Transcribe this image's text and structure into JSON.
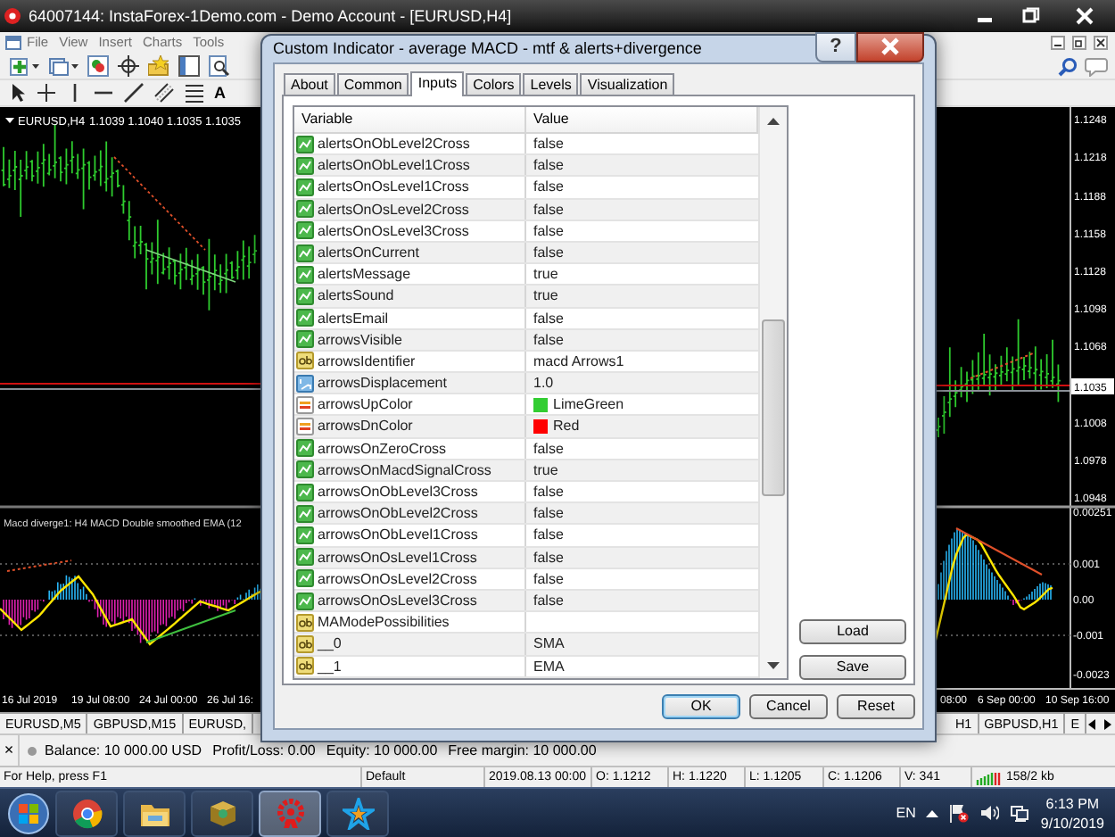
{
  "window": {
    "title": "64007144: InstaForex-1Demo.com - Demo Account - [EURUSD,H4]"
  },
  "menu": [
    "File",
    "View",
    "Insert",
    "Charts",
    "Tools"
  ],
  "text_tool": "A",
  "left_chart": {
    "symbol": "EURUSD,H4",
    "quote": "1.1039 1.1040 1.1035 1.1035",
    "indicator_label": "Macd diverge1: H4 MACD Double smoothed EMA (12",
    "time_labels": [
      "16 Jul 2019",
      "19 Jul 08:00",
      "24 Jul 00:00",
      "26 Jul 16:"
    ]
  },
  "right_chart": {
    "price_labels": [
      "1.1248",
      "1.1218",
      "1.1188",
      "1.1158",
      "1.1128",
      "1.1098",
      "1.1068",
      "1.1008",
      "1.0978",
      "1.0948"
    ],
    "current_price": "1.1035",
    "indicator_labels": [
      "0.00251",
      "0.001",
      "0.00",
      "-0.001",
      "-0.0023"
    ],
    "time_labels": [
      "08:00",
      "6 Sep 00:00",
      "10 Sep 16:00"
    ]
  },
  "dialog": {
    "title": "Custom Indicator - average MACD - mtf & alerts+divergence",
    "help": "?",
    "tabs": [
      {
        "label": "About",
        "selected": false
      },
      {
        "label": "Common",
        "selected": false
      },
      {
        "label": "Inputs",
        "selected": true
      },
      {
        "label": "Colors",
        "selected": false
      },
      {
        "label": "Levels",
        "selected": false
      },
      {
        "label": "Visualization",
        "selected": false
      }
    ],
    "table": {
      "columns": [
        "Variable",
        "Value"
      ],
      "rows": [
        {
          "kind": "bool",
          "variable": "alertsOnObLevel2Cross",
          "value": "false"
        },
        {
          "kind": "bool",
          "variable": "alertsOnObLevel1Cross",
          "value": "false"
        },
        {
          "kind": "bool",
          "variable": "alertsOnOsLevel1Cross",
          "value": "false"
        },
        {
          "kind": "bool",
          "variable": "alertsOnOsLevel2Cross",
          "value": "false"
        },
        {
          "kind": "bool",
          "variable": "alertsOnOsLevel3Cross",
          "value": "false"
        },
        {
          "kind": "bool",
          "variable": "alertsOnCurrent",
          "value": "false"
        },
        {
          "kind": "bool",
          "variable": "alertsMessage",
          "value": "true"
        },
        {
          "kind": "bool",
          "variable": "alertsSound",
          "value": "true"
        },
        {
          "kind": "bool",
          "variable": "alertsEmail",
          "value": "false"
        },
        {
          "kind": "bool",
          "variable": "arrowsVisible",
          "value": "false"
        },
        {
          "kind": "string",
          "variable": "arrowsIdentifier",
          "value": "macd Arrows1"
        },
        {
          "kind": "double",
          "variable": "arrowsDisplacement",
          "value": "1.0"
        },
        {
          "kind": "color",
          "variable": "arrowsUpColor",
          "value": "LimeGreen",
          "color": "#32cd32"
        },
        {
          "kind": "color",
          "variable": "arrowsDnColor",
          "value": "Red",
          "color": "#ff0000"
        },
        {
          "kind": "bool",
          "variable": "arrowsOnZeroCross",
          "value": "false"
        },
        {
          "kind": "bool",
          "variable": "arrowsOnMacdSignalCross",
          "value": "true"
        },
        {
          "kind": "bool",
          "variable": "arrowsOnObLevel3Cross",
          "value": "false"
        },
        {
          "kind": "bool",
          "variable": "arrowsOnObLevel2Cross",
          "value": "false"
        },
        {
          "kind": "bool",
          "variable": "arrowsOnObLevel1Cross",
          "value": "false"
        },
        {
          "kind": "bool",
          "variable": "arrowsOnOsLevel1Cross",
          "value": "false"
        },
        {
          "kind": "bool",
          "variable": "arrowsOnOsLevel2Cross",
          "value": "false"
        },
        {
          "kind": "bool",
          "variable": "arrowsOnOsLevel3Cross",
          "value": "false"
        },
        {
          "kind": "string",
          "variable": "MAModePossibilities"
        },
        {
          "kind": "string",
          "variable": "__0",
          "value": "SMA"
        },
        {
          "kind": "string",
          "variable": "__1",
          "value": "EMA"
        }
      ]
    },
    "side_buttons": [
      "Load",
      "Save"
    ],
    "buttons": [
      "OK",
      "Cancel",
      "Reset"
    ]
  },
  "chart_tabs": {
    "left": [
      "EURUSD,M5",
      "GBPUSD,M15",
      "EURUSD,"
    ],
    "right": [
      "H1",
      "GBPUSD,H1",
      "E"
    ]
  },
  "terminal": {
    "close": "×",
    "items": [
      "Balance: 10 000.00 USD",
      "Profit/Loss: 0.00",
      "Equity: 10 000.00",
      "Free margin: 10 000.00"
    ]
  },
  "status_bar": [
    "For Help, press F1",
    "Default",
    "2019.08.13 00:00",
    "O: 1.1212",
    "H: 1.1220",
    "L: 1.1205",
    "C: 1.1206",
    "V: 341",
    "158/2 kb"
  ],
  "taskbar": {
    "language": "EN",
    "time": "6:13 PM",
    "date": "9/10/2019"
  }
}
